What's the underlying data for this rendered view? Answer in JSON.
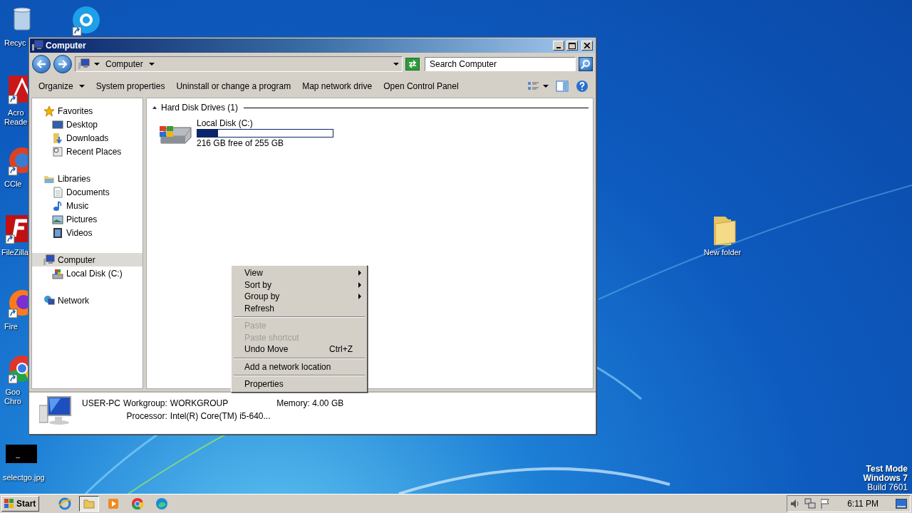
{
  "desktop_icons": [
    {
      "kind": "recycle",
      "label_lines": [
        "Recyc"
      ]
    },
    {
      "kind": "skype"
    },
    {
      "kind": "acrobat",
      "label_lines": [
        "Acro",
        "Reade"
      ]
    },
    {
      "kind": "ccleaner",
      "label_lines": [
        "CCle"
      ]
    },
    {
      "kind": "filezilla",
      "label_lines": [
        "FileZilla"
      ]
    },
    {
      "kind": "firefox",
      "label_lines": [
        "Fire"
      ]
    },
    {
      "kind": "chrome",
      "label_lines": [
        "Goo",
        "Chro"
      ]
    },
    {
      "kind": "image",
      "label_lines": [
        "selectgo.jpg"
      ]
    },
    {
      "kind": "folder",
      "label_lines": [
        "New folder"
      ]
    }
  ],
  "window": {
    "title": "Computer",
    "address": {
      "crumbs": [
        "Computer"
      ]
    },
    "search": {
      "placeholder": "Search Computer"
    },
    "toolbar": [
      "Organize",
      "System properties",
      "Uninstall or change a program",
      "Map network drive",
      "Open Control Panel"
    ],
    "sidebar": {
      "items": [
        {
          "label": "Favorites",
          "kind": "star",
          "selected": false,
          "children": [
            {
              "label": "Desktop",
              "kind": "desktop",
              "selected": false
            },
            {
              "label": "Downloads",
              "kind": "downloads",
              "selected": false
            },
            {
              "label": "Recent Places",
              "kind": "recent",
              "selected": false
            }
          ]
        },
        {
          "label": "Libraries",
          "kind": "library",
          "selected": false,
          "children": [
            {
              "label": "Documents",
              "kind": "document",
              "selected": false
            },
            {
              "label": "Music",
              "kind": "music",
              "selected": false
            },
            {
              "label": "Pictures",
              "kind": "pictures",
              "selected": false
            },
            {
              "label": "Videos",
              "kind": "videos",
              "selected": false
            }
          ]
        },
        {
          "label": "Computer",
          "kind": "computer",
          "selected": true,
          "children": [
            {
              "label": "Local Disk (C:)",
              "kind": "disk",
              "selected": false
            }
          ]
        },
        {
          "label": "Network",
          "kind": "network",
          "selected": false
        }
      ]
    },
    "group": {
      "title": "Hard Disk Drives (1)",
      "expanded": true,
      "drives": [
        {
          "name": "Local Disk (C:)",
          "level": 0.15,
          "free": "216 GB free of 255 GB"
        }
      ]
    },
    "details": {
      "name": "USER-PC",
      "workgroup_label": "Workgroup:",
      "workgroup": "WORKGROUP",
      "memory_label": "Memory:",
      "memory": "4.00 GB",
      "processor_label": "Processor:",
      "processor": "Intel(R) Core(TM) i5-640..."
    }
  },
  "context_menu": [
    {
      "kind": "item",
      "label": "View",
      "submenu": true,
      "disabled": false
    },
    {
      "kind": "item",
      "label": "Sort by",
      "submenu": true,
      "disabled": false
    },
    {
      "kind": "item",
      "label": "Group by",
      "submenu": true,
      "disabled": false
    },
    {
      "kind": "item",
      "label": "Refresh",
      "submenu": false,
      "disabled": false
    },
    {
      "kind": "separator"
    },
    {
      "kind": "item",
      "label": "Paste",
      "submenu": false,
      "disabled": true
    },
    {
      "kind": "item",
      "label": "Paste shortcut",
      "submenu": false,
      "disabled": true
    },
    {
      "kind": "item",
      "label": "Undo Move",
      "submenu": false,
      "disabled": false,
      "shortcut": "Ctrl+Z"
    },
    {
      "kind": "separator"
    },
    {
      "kind": "item",
      "label": "Add a network location",
      "submenu": false,
      "disabled": false
    },
    {
      "kind": "separator"
    },
    {
      "kind": "item",
      "label": "Properties",
      "submenu": false,
      "disabled": false
    }
  ],
  "edition": [
    "Test Mode",
    "Windows 7",
    "Build 7601"
  ],
  "taskbar": {
    "start": "Start",
    "apps": [
      {
        "kind": "ie",
        "selected": false
      },
      {
        "kind": "explorer",
        "selected": true
      },
      {
        "kind": "media",
        "selected": false
      },
      {
        "kind": "chrome",
        "selected": false
      },
      {
        "kind": "edge",
        "selected": false
      }
    ],
    "clock": "6:11 PM"
  }
}
